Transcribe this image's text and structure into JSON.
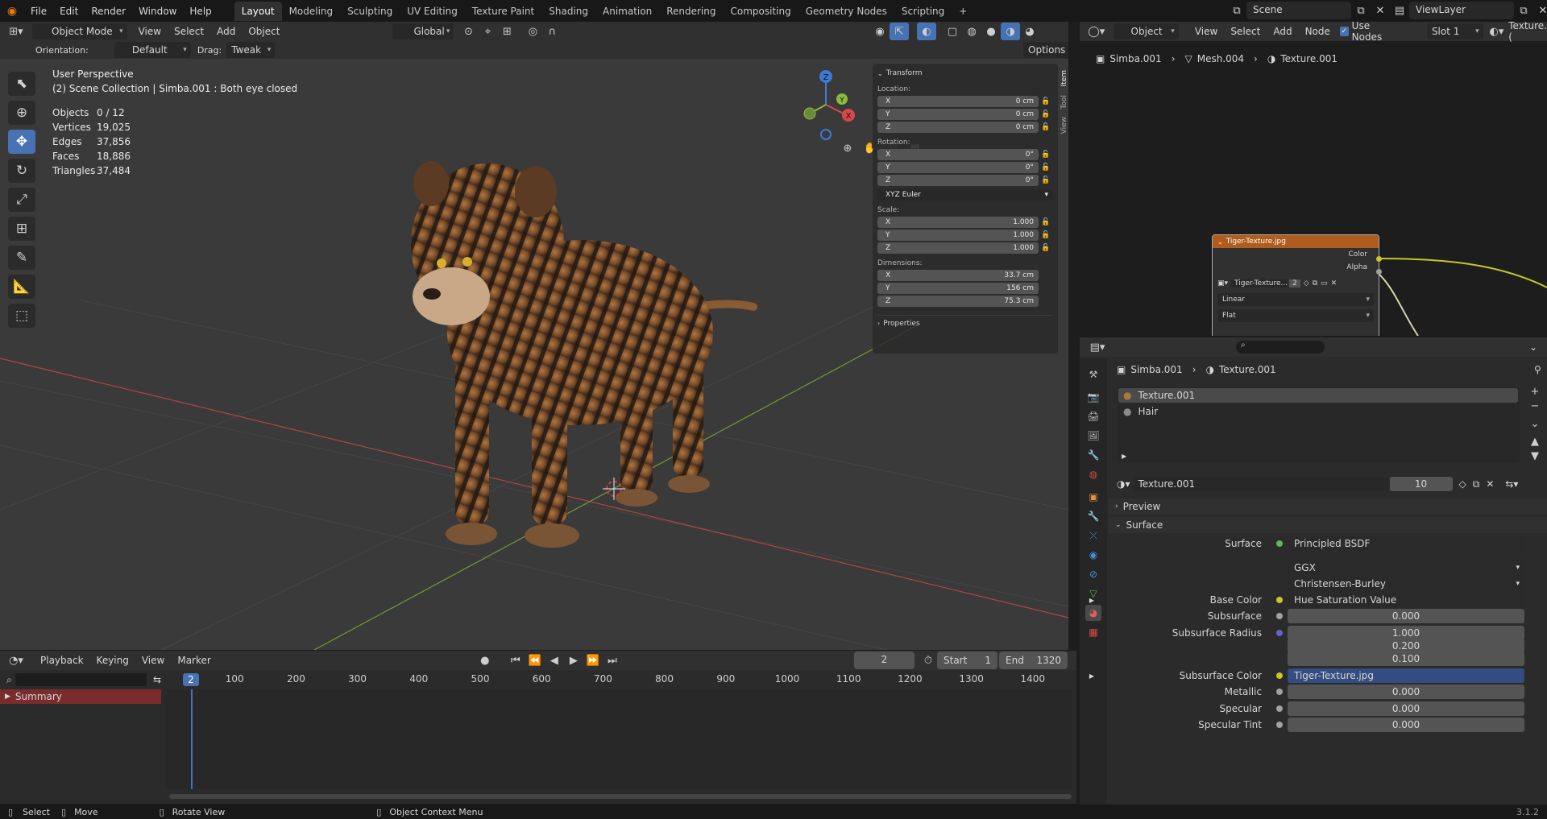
{
  "topbar": {
    "menus": [
      "File",
      "Edit",
      "Render",
      "Window",
      "Help"
    ],
    "workspaces": [
      "Layout",
      "Modeling",
      "Sculpting",
      "UV Editing",
      "Texture Paint",
      "Shading",
      "Animation",
      "Rendering",
      "Compositing",
      "Geometry Nodes",
      "Scripting"
    ],
    "active_workspace": "Layout",
    "add_tab": "+",
    "scene": "Scene",
    "view_layer": "ViewLayer"
  },
  "viewport_header": {
    "mode": "Object Mode",
    "menus": [
      "View",
      "Select",
      "Add",
      "Object"
    ],
    "transform_orientation": "Global"
  },
  "tool_settings": {
    "orientation_label": "Orientation:",
    "orientation_value": "Default",
    "drag_label": "Drag:",
    "drag_value": "Tweak",
    "options": "Options"
  },
  "viewport": {
    "view_name": "User Perspective",
    "collection_info": "(2) Scene Collection | Simba.001 : Both eye closed",
    "stats": [
      {
        "label": "Objects",
        "value": "0 / 12"
      },
      {
        "label": "Vertices",
        "value": "19,025"
      },
      {
        "label": "Edges",
        "value": "37,856"
      },
      {
        "label": "Faces",
        "value": "18,886"
      },
      {
        "label": "Triangles",
        "value": "37,484"
      }
    ],
    "gizmo_axes": [
      "Z",
      "Y",
      "X"
    ]
  },
  "npanel": {
    "tabs": [
      "Item",
      "Tool",
      "View"
    ],
    "transform_title": "Transform",
    "location_label": "Location:",
    "location": [
      {
        "axis": "X",
        "value": "0 cm"
      },
      {
        "axis": "Y",
        "value": "0 cm"
      },
      {
        "axis": "Z",
        "value": "0 cm"
      }
    ],
    "rotation_label": "Rotation:",
    "rotation": [
      {
        "axis": "X",
        "value": "0°"
      },
      {
        "axis": "Y",
        "value": "0°"
      },
      {
        "axis": "Z",
        "value": "0°"
      }
    ],
    "rotation_mode": "XYZ Euler",
    "scale_label": "Scale:",
    "scale": [
      {
        "axis": "X",
        "value": "1.000"
      },
      {
        "axis": "Y",
        "value": "1.000"
      },
      {
        "axis": "Z",
        "value": "1.000"
      }
    ],
    "dimensions_label": "Dimensions:",
    "dimensions": [
      {
        "axis": "X",
        "value": "33.7 cm"
      },
      {
        "axis": "Y",
        "value": "156 cm"
      },
      {
        "axis": "Z",
        "value": "75.3 cm"
      }
    ],
    "properties_title": "Properties"
  },
  "node_editor": {
    "object_type": "Object",
    "menus": [
      "View",
      "Select",
      "Add",
      "Node"
    ],
    "use_nodes_label": "Use Nodes",
    "slot": "Slot 1",
    "material_field": "Texture.(",
    "breadcrumb": [
      "Simba.001",
      "Mesh.004",
      "Texture.001"
    ],
    "node": {
      "title": "Tiger-Texture.jpg",
      "outputs": [
        "Color",
        "Alpha"
      ],
      "image_name": "Tiger-Texture...",
      "users": "2",
      "interpolation": "Linear",
      "projection": "Flat"
    }
  },
  "properties_editor": {
    "breadcrumb": [
      "Simba.001",
      "Texture.001"
    ],
    "material_slots": [
      "Texture.001",
      "Hair"
    ],
    "material_name": "Texture.001",
    "material_users": "10",
    "preview_label": "Preview",
    "surface_label": "Surface",
    "rows": [
      {
        "label": "Surface",
        "value": "Principled BSDF",
        "kind": "link",
        "dot": "#5fb55f"
      },
      {
        "label": "",
        "value": "GGX",
        "kind": "drop"
      },
      {
        "label": "",
        "value": "Christensen-Burley",
        "kind": "drop"
      },
      {
        "label": "Base Color",
        "value": "Hue Saturation Value",
        "kind": "link",
        "dot": "#c7c729",
        "expand": true
      },
      {
        "label": "Subsurface",
        "value": "0.000",
        "kind": "num",
        "dot": "#a1a1a1"
      },
      {
        "label": "Subsurface Radius",
        "value": "1.000",
        "kind": "num",
        "dot": "#6363c7"
      },
      {
        "label": "",
        "value": "0.200",
        "kind": "num"
      },
      {
        "label": "",
        "value": "0.100",
        "kind": "num"
      },
      {
        "label": "Subsurface Color",
        "value": "Tiger-Texture.jpg",
        "kind": "sel",
        "dot": "#c7c729",
        "expand": true
      },
      {
        "label": "Metallic",
        "value": "0.000",
        "kind": "num",
        "dot": "#a1a1a1"
      },
      {
        "label": "Specular",
        "value": "0.000",
        "kind": "num",
        "dot": "#a1a1a1"
      },
      {
        "label": "Specular Tint",
        "value": "0.000",
        "kind": "num",
        "dot": "#a1a1a1"
      }
    ]
  },
  "timeline": {
    "menus": [
      "Playback",
      "Keying",
      "View",
      "Marker"
    ],
    "current_frame": "2",
    "start_label": "Start",
    "start": "1",
    "end_label": "End",
    "end": "1320",
    "ruler": [
      "100",
      "200",
      "300",
      "400",
      "500",
      "600",
      "700",
      "800",
      "900",
      "1000",
      "1100",
      "1200",
      "1300",
      "1400"
    ],
    "playhead": "2",
    "summary": "Summary"
  },
  "statusbar": {
    "select": "Select",
    "move": "Move",
    "rotate": "Rotate View",
    "context": "Object Context Menu",
    "version": "3.1.2"
  },
  "colors": {
    "accent": "#4772b3",
    "x_axis": "#d94848",
    "y_axis": "#8cbb39",
    "z_axis": "#3d7ad8",
    "node_header": "#b05c1e"
  }
}
